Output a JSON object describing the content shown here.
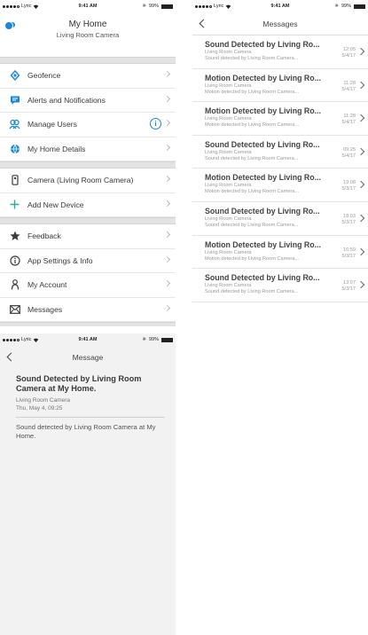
{
  "status_bar": {
    "carrier": "Lyric",
    "time": "9:41 AM",
    "battery_home": "99%",
    "battery_other": "99%"
  },
  "home": {
    "title": "My Home",
    "subtitle": "Living Room Camera",
    "section1": [
      {
        "label": "Geofence",
        "icon": "geofence-icon"
      },
      {
        "label": "Alerts and Notifications",
        "icon": "chat-bubble-icon"
      },
      {
        "label": "Manage Users",
        "icon": "users-icon",
        "badge": "i"
      },
      {
        "label": "My Home Details",
        "icon": "globe-icon"
      }
    ],
    "section2": [
      {
        "label": "Camera (Living Room Camera)",
        "icon": "camera-device-icon"
      },
      {
        "label": "Add New Device",
        "icon": "plus-icon"
      }
    ],
    "section3": [
      {
        "label": "Feedback",
        "icon": "star-icon"
      },
      {
        "label": "App Settings & Info",
        "icon": "info-icon"
      },
      {
        "label": "My Account",
        "icon": "person-icon"
      },
      {
        "label": "Messages",
        "icon": "envelope-icon"
      }
    ]
  },
  "messages": {
    "title": "Messages",
    "items": [
      {
        "title": "Sound Detected by Living Ro...",
        "line1": "Living Room Camera",
        "line2": "Sound detected by Living Room Camera...",
        "time": "12:05",
        "date": "5/4/17"
      },
      {
        "title": "Motion Detected by Living Ro...",
        "line1": "Living Room Camera",
        "line2": "Motion detected by Living Room Camera...",
        "time": "11:28",
        "date": "5/4/17"
      },
      {
        "title": "Motion Detected by Living Ro...",
        "line1": "Living Room Camera",
        "line2": "Motion detected by Living Room Camera...",
        "time": "11:28",
        "date": "5/4/17"
      },
      {
        "title": "Sound Detected by Living Ro...",
        "line1": "Living Room Camera",
        "line2": "Sound detected by Living Room Camera...",
        "time": "09:25",
        "date": "5/4/17"
      },
      {
        "title": "Motion Detected by Living Ro...",
        "line1": "Living Room Camera",
        "line2": "Motion detected by Living Room Camera...",
        "time": "19:08",
        "date": "5/3/17"
      },
      {
        "title": "Sound Detected by Living Ro...",
        "line1": "Living Room Camera",
        "line2": "Sound detected by Living Room Camera...",
        "time": "18:03",
        "date": "5/3/17"
      },
      {
        "title": "Motion Detected by Living Ro...",
        "line1": "Living Room Camera",
        "line2": "Motion detected by Living Room Camera...",
        "time": "16:59",
        "date": "5/3/17"
      },
      {
        "title": "Sound Detected by Living Ro...",
        "line1": "Living Room Camera",
        "line2": "Sound detected by Living Room Camera...",
        "time": "13:07",
        "date": "5/3/17"
      }
    ]
  },
  "detail": {
    "title": "Message",
    "heading": "Sound Detected by Living Room Camera at My Home.",
    "device": "Living Room Camera",
    "timestamp": "Thu, May 4, 09:25",
    "body": "Sound detected by Living Room Camera at My Home."
  },
  "colors": {
    "accent": "#1a87d8",
    "separator": "#e3e3e3",
    "detail_bg": "#f2f2f2"
  }
}
